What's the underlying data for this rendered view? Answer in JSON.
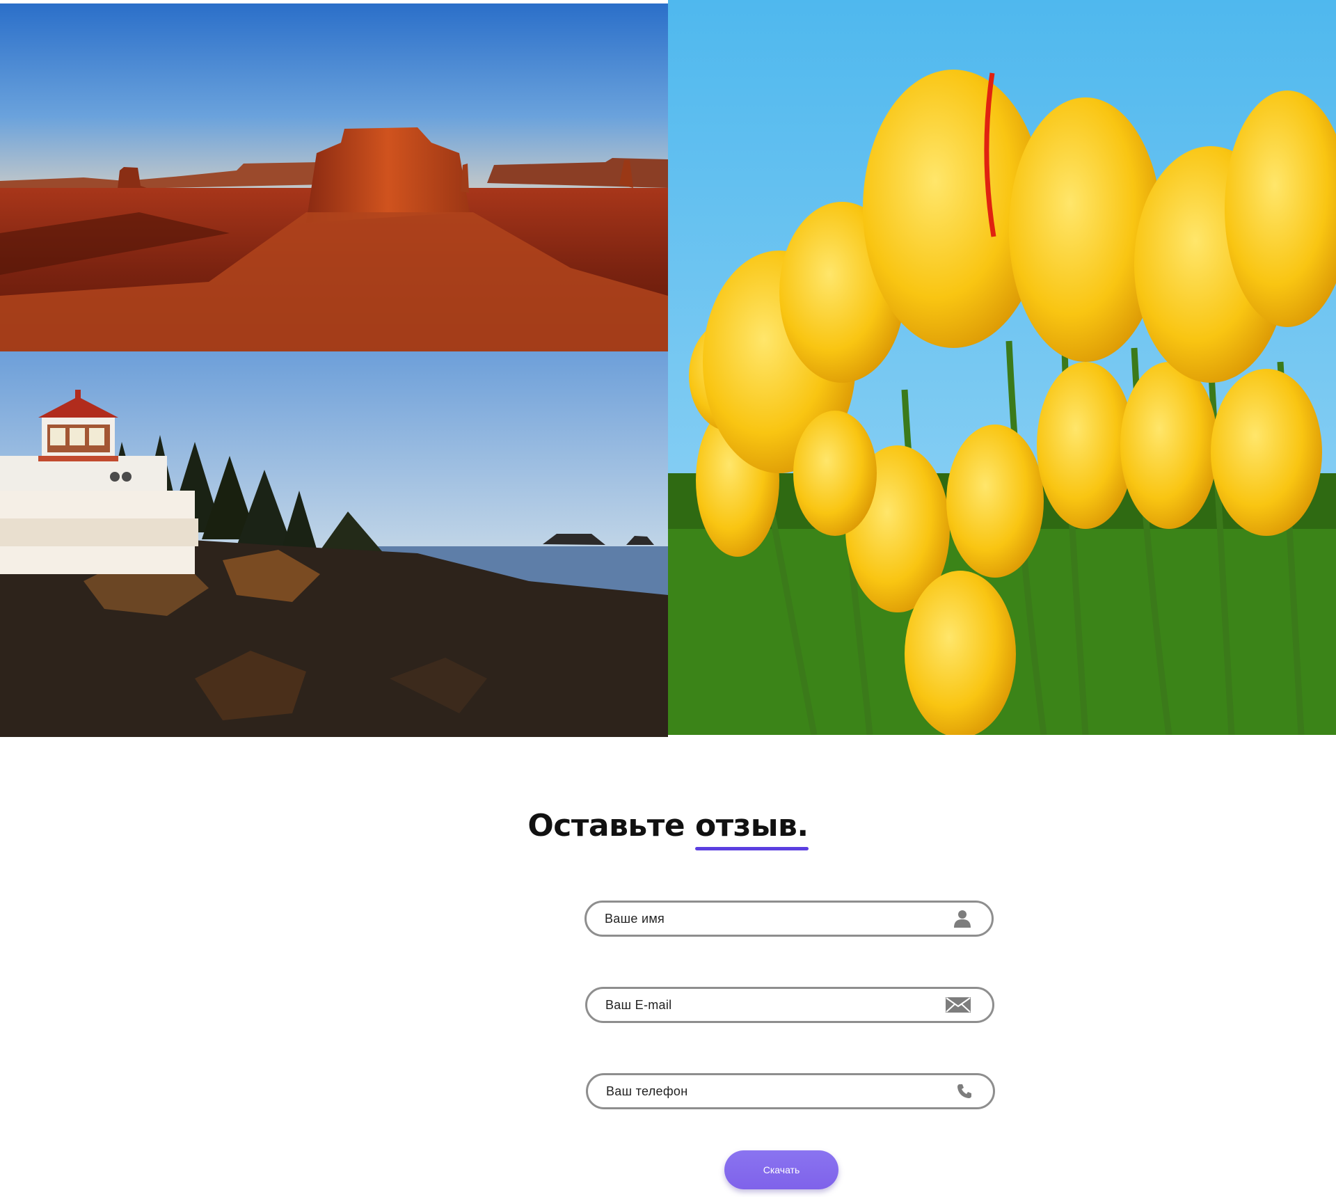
{
  "gallery": {
    "images": [
      {
        "name": "desert-mesa-photo"
      },
      {
        "name": "lighthouse-photo"
      },
      {
        "name": "yellow-tulips-photo"
      }
    ]
  },
  "feedback": {
    "title_main": "Оставьте",
    "title_accent": "отзыв.",
    "accent_color": "#5b3fe0",
    "fields": {
      "name": {
        "label": "Ваше имя",
        "icon": "user-icon"
      },
      "email": {
        "label": "Ваш E-mail",
        "icon": "envelope-icon"
      },
      "phone": {
        "label": "Ваш телефон",
        "icon": "phone-icon"
      }
    },
    "submit_label": "Скачать",
    "button_color": "#8470ee"
  }
}
